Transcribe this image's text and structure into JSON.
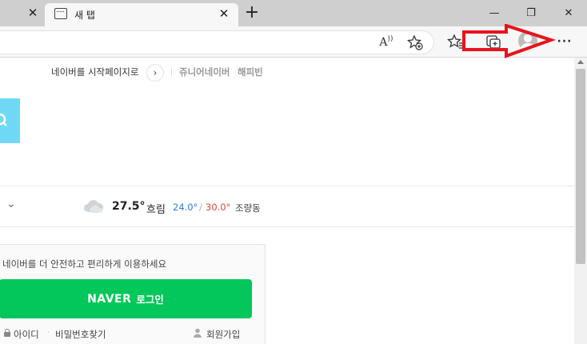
{
  "tabs": [
    {
      "title": "",
      "active": false
    },
    {
      "title": "새 탭",
      "active": true
    }
  ],
  "new_tab_symbol": "+",
  "window": {
    "minimize": "—",
    "restore": "❐",
    "close": "✕"
  },
  "toolbar": {
    "read_aloud_label": "Ā",
    "more_label": "···"
  },
  "naver_page": {
    "start_page_link": "네이버를 시작페이지로",
    "junior_naver": "쥬니어네이버",
    "happybean": "해피빈",
    "weather": {
      "temp": "27.5°",
      "condition": "흐림",
      "low": "24.0°",
      "slash": "/",
      "high": "30.0°",
      "location": "조량동"
    },
    "login": {
      "message": "네이버를 더 안전하고 편리하게 이용하세요",
      "button_brand": "NAVER",
      "button_text": "로그인",
      "find_id": "아이디",
      "find_pw": "비밀번호찾기",
      "signup": "회원가입"
    }
  },
  "colors": {
    "naver_green": "#03c75a",
    "search_blue": "#6fd9f5",
    "temp_low": "#2b7de0",
    "temp_high": "#e0473d",
    "annotation_red": "#e8141c"
  }
}
